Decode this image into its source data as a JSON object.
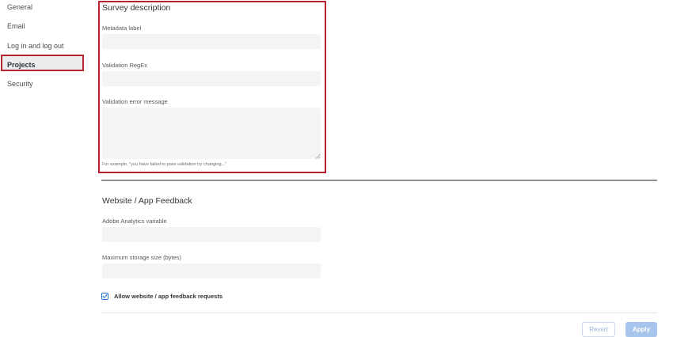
{
  "sidebar": {
    "items": [
      {
        "label": "General",
        "active": false
      },
      {
        "label": "Email",
        "active": false
      },
      {
        "label": "Log in and log out",
        "active": false
      },
      {
        "label": "Projects",
        "active": true
      },
      {
        "label": "Security",
        "active": false
      }
    ]
  },
  "survey_description": {
    "title": "Survey description",
    "metadata_label": {
      "label": "Metadata label",
      "value": ""
    },
    "validation_regex": {
      "label": "Validation RegEx",
      "value": ""
    },
    "validation_error_message": {
      "label": "Validation error message",
      "value": ""
    },
    "hint": "For example, \"you have failed to pass validation try changing...\""
  },
  "website_app_feedback": {
    "title": "Website / App Feedback",
    "adobe_analytics_variable": {
      "label": "Adobe Analytics variable",
      "value": ""
    },
    "maximum_storage_size": {
      "label": "Maximum storage size (bytes)",
      "value": ""
    },
    "allow_requests": {
      "label": "Allow website / app feedback requests",
      "checked": true
    }
  },
  "actions": {
    "revert_label": "Revert",
    "apply_label": "Apply"
  },
  "colors": {
    "highlight": "#b5232f",
    "accent": "#1f6fd4",
    "button_disabled": "#a7c4ec"
  },
  "icons": {
    "checkbox_check": "check-icon",
    "textarea_resize": "resize-grip-icon"
  }
}
